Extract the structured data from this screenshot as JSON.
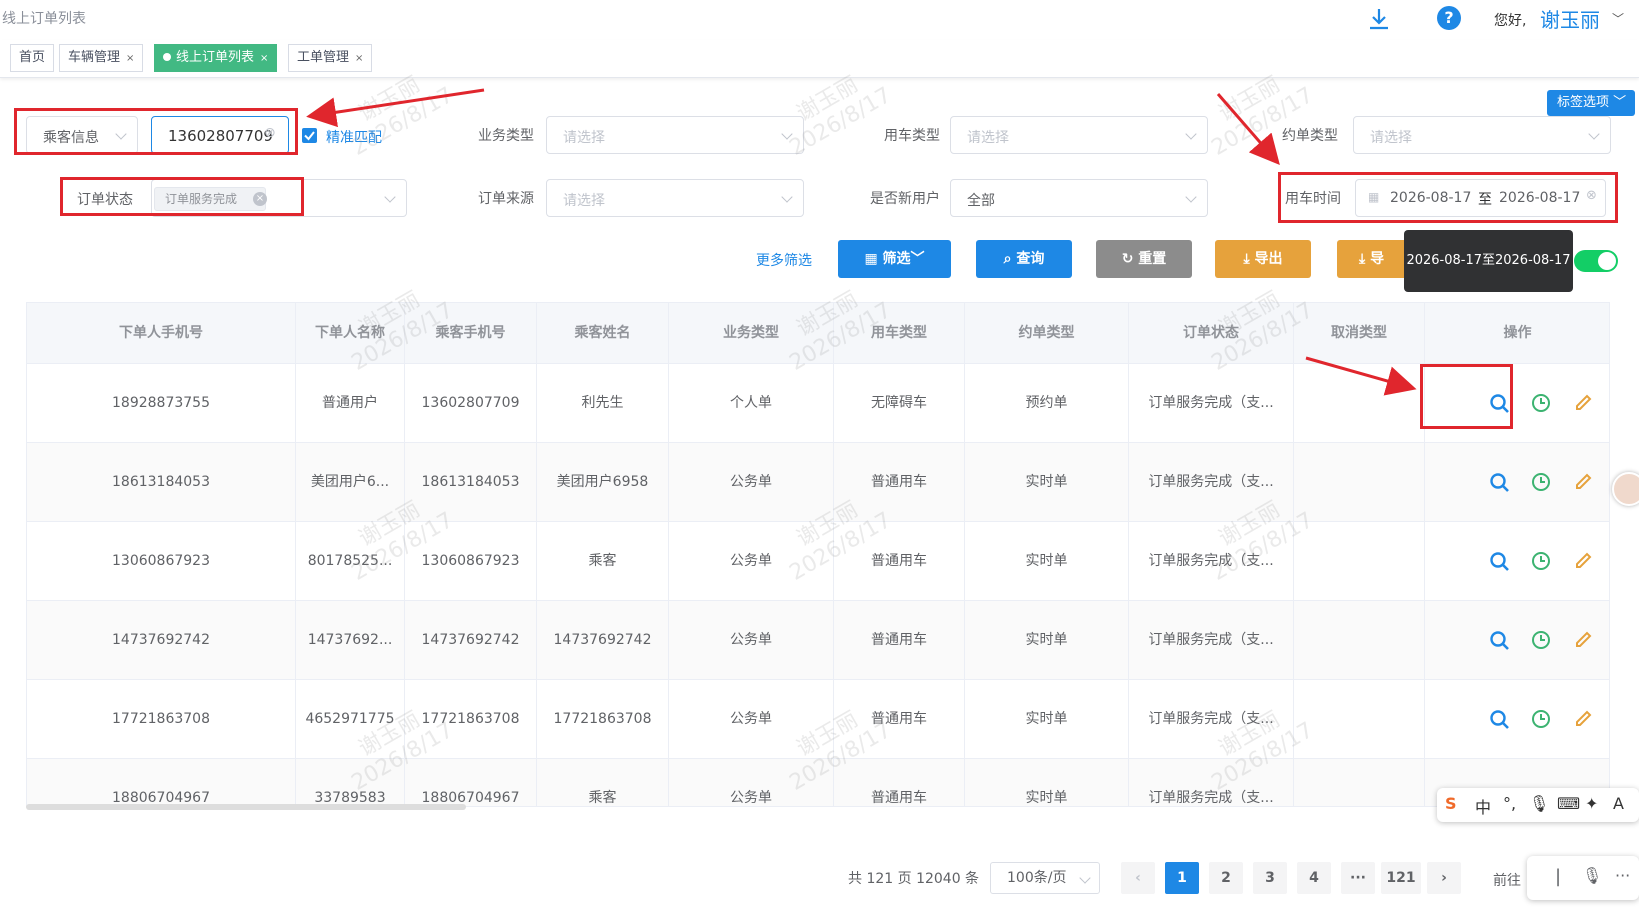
{
  "header": {
    "breadcrumb": "线上订单列表",
    "greeting": "您好,",
    "username": "谢玉丽"
  },
  "tabs": [
    {
      "label": "首页",
      "closable": false
    },
    {
      "label": "车辆管理",
      "closable": true
    },
    {
      "label": "线上订单列表",
      "closable": true,
      "active": true
    },
    {
      "label": "工单管理",
      "closable": true
    }
  ],
  "tab_options_label": "标签选项",
  "close_glyph": "×",
  "filters": {
    "passenger_info_select": "乘客信息",
    "passenger_info_value": "13602807709",
    "exact_match_label": "精准匹配",
    "business_type_label": "业务类型",
    "business_type_placeholder": "请选择",
    "car_type_label": "用车类型",
    "car_type_placeholder": "请选择",
    "booking_type_label": "约单类型",
    "booking_type_placeholder": "请选择",
    "order_status_label": "订单状态",
    "order_status_tag": "订单服务完成",
    "order_source_label": "订单来源",
    "order_source_placeholder": "请选择",
    "new_user_label": "是否新用户",
    "new_user_value": "全部",
    "use_time_label": "用车时间",
    "use_time_start": "2026-08-17",
    "use_time_sep": "至",
    "use_time_end": "2026-08-17"
  },
  "actions": {
    "more_filter": "更多筛选",
    "filter": "筛选",
    "query": "查询",
    "reset": "重置",
    "export": "导出",
    "export2_partial": "导",
    "tooltip": "2026-08-17至2026-08-17",
    "toggle_on": true
  },
  "table": {
    "columns": [
      "下单人手机号",
      "下单人名称",
      "乘客手机号",
      "乘客姓名",
      "业务类型",
      "用车类型",
      "约单类型",
      "订单状态",
      "取消类型",
      "操作"
    ],
    "rows": [
      [
        "18928873755",
        "普通用户",
        "13602807709",
        "利先生",
        "个人单",
        "无障碍车",
        "预约单",
        "订单服务完成（支...",
        ""
      ],
      [
        "18613184053",
        "美团用户6...",
        "18613184053",
        "美团用户6958",
        "公务单",
        "普通用车",
        "实时单",
        "订单服务完成（支...",
        ""
      ],
      [
        "13060867923",
        "80178525...",
        "13060867923",
        "乘客",
        "公务单",
        "普通用车",
        "实时单",
        "订单服务完成（支...",
        ""
      ],
      [
        "14737692742",
        "14737692...",
        "14737692742",
        "14737692742",
        "公务单",
        "普通用车",
        "实时单",
        "订单服务完成（支...",
        ""
      ],
      [
        "17721863708",
        "4652971775",
        "17721863708",
        "17721863708",
        "公务单",
        "普通用车",
        "实时单",
        "订单服务完成（支...",
        ""
      ],
      [
        "18806704967",
        "33789583",
        "18806704967",
        "乘客",
        "公务单",
        "普通用车",
        "实时单",
        "订单服务完成（支...",
        ""
      ]
    ],
    "row_action_icons": [
      "search-icon",
      "clock-icon",
      "edit-icon"
    ]
  },
  "watermark": {
    "line1": "谢玉丽",
    "line2": "2026/8/17"
  },
  "pagination": {
    "total": "共 121 页 12040 条",
    "page_size": "100条/页",
    "pages": [
      "1",
      "2",
      "3",
      "4",
      "···",
      "121"
    ],
    "current": "1",
    "prev": "‹",
    "next": "›",
    "goto": "前往"
  },
  "ime": {
    "chars": [
      "中",
      "°,"
    ]
  },
  "colors": {
    "primary": "#1e88e5",
    "tab_active": "#42b983",
    "warning": "#e6a23c",
    "annotation_red": "#e0262d",
    "success": "#13ce66"
  }
}
